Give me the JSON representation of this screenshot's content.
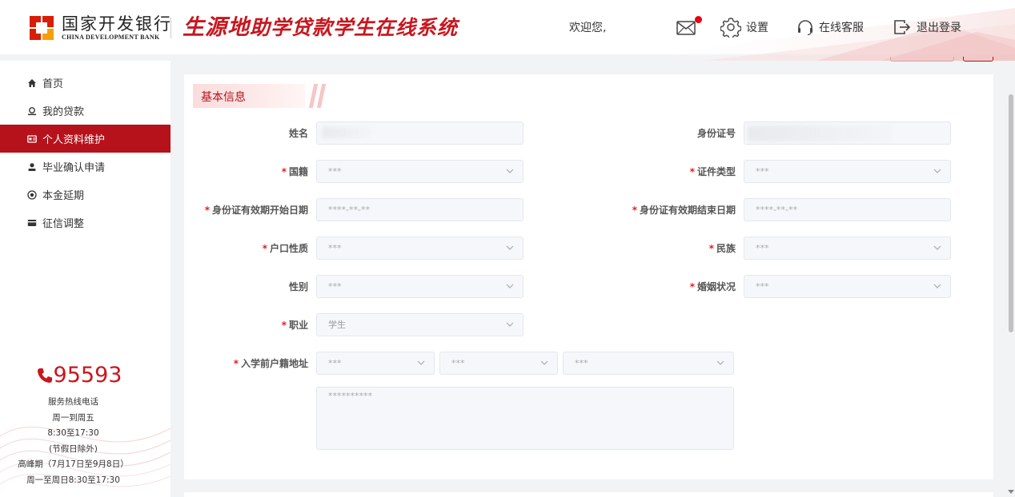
{
  "header": {
    "bank_name_cn": "国家开发银行",
    "bank_name_en": "CHINA DEVELOPMENT BANK",
    "system_title_a": "生源地",
    "system_title_b": "助学贷款学生在线系统",
    "welcome": "欢迎您,",
    "settings_label": "设置",
    "service_label": "在线客服",
    "logout_label": "退出登录",
    "accent_color": "#c8161e"
  },
  "sidebar": {
    "items": [
      {
        "label": "首页",
        "icon": "home-icon",
        "active": false
      },
      {
        "label": "我的贷款",
        "icon": "loan-icon",
        "active": false
      },
      {
        "label": "个人资料维护",
        "icon": "id-card-icon",
        "active": true
      },
      {
        "label": "毕业确认申请",
        "icon": "user-icon",
        "active": false
      },
      {
        "label": "本金延期",
        "icon": "target-icon",
        "active": false
      },
      {
        "label": "征信调整",
        "icon": "card-icon",
        "active": false
      }
    ],
    "hotline": {
      "number": "95593",
      "lines": [
        "服务热线电话",
        "周一到周五",
        "8:30至17:30",
        "(节假日除外)",
        "高峰期（7月17日至9月8日）",
        "周一至周日8:30至17:30"
      ]
    }
  },
  "form": {
    "section_title": "基本信息",
    "name_label": "姓名",
    "idno_label": "身份证号",
    "nationality_label": "国籍",
    "nationality_value": "***",
    "idtype_label": "证件类型",
    "idtype_value": "***",
    "id_start_label": "身份证有效期开始日期",
    "id_start_value": "****-**-**",
    "id_end_label": "身份证有效期结束日期",
    "id_end_value": "****-**-**",
    "hukou_label": "户口性质",
    "hukou_value": "***",
    "ethnic_label": "民族",
    "ethnic_value": "***",
    "gender_label": "性别",
    "gender_value": "***",
    "marital_label": "婚姻状况",
    "marital_value": "***",
    "job_label": "职业",
    "job_value": "学生",
    "address_label": "入学前户籍地址",
    "province_value": "***",
    "city_value": "***",
    "county_value": "***",
    "address_detail": "**********"
  }
}
